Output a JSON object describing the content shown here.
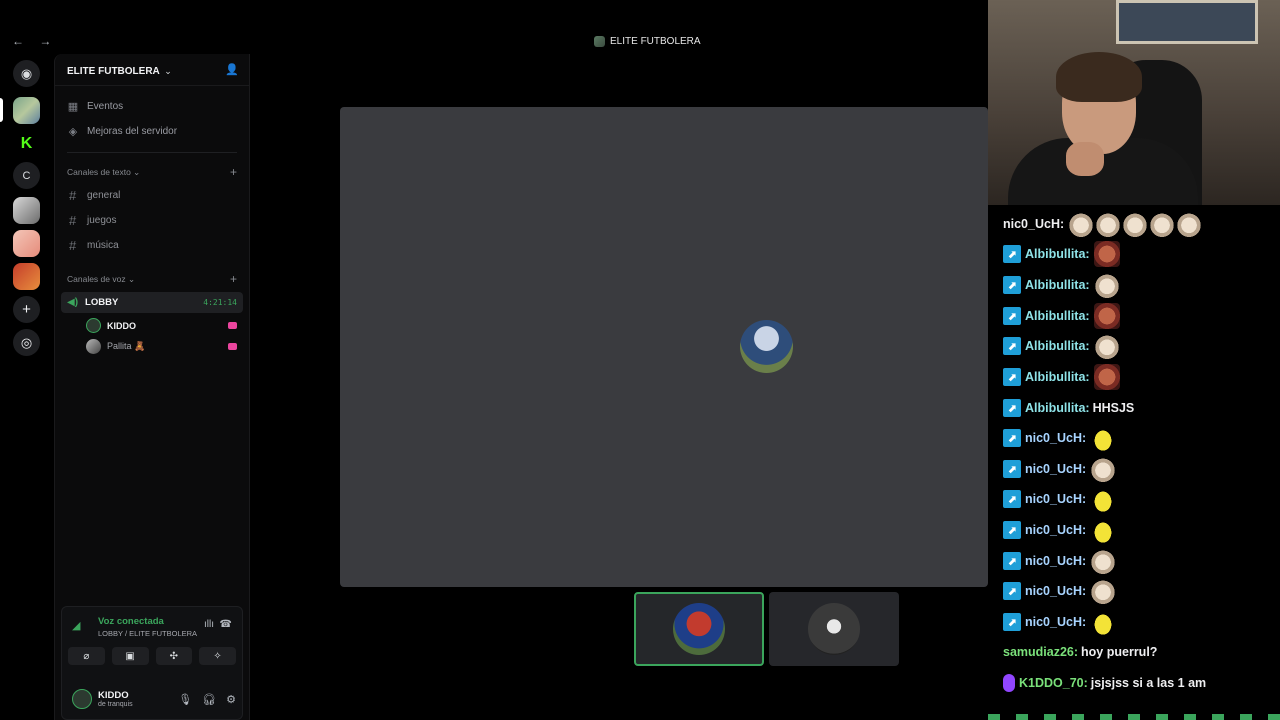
{
  "window": {
    "title": "ELITE FUTBOLERA",
    "nav": "← →"
  },
  "rail": {
    "items": [
      {
        "name": "discord-home-icon",
        "glyph": "◉"
      },
      {
        "name": "server-elite-futbolera",
        "glyph": ""
      },
      {
        "name": "server-k",
        "glyph": "K"
      },
      {
        "name": "server-c",
        "glyph": "C"
      },
      {
        "name": "server-4",
        "glyph": ""
      },
      {
        "name": "server-5",
        "glyph": ""
      },
      {
        "name": "server-6",
        "glyph": ""
      },
      {
        "name": "add-server-icon",
        "glyph": "+"
      },
      {
        "name": "discover-icon",
        "glyph": "◎"
      }
    ]
  },
  "sidebar": {
    "guild_name": "ELITE FUTBOLERA",
    "guild_chevron": "⌄",
    "invite_icon": "👤",
    "top_items": [
      {
        "label": "Eventos",
        "icon": "calendar-icon",
        "glyph": "▦"
      },
      {
        "label": "Mejoras del servidor",
        "icon": "boost-icon",
        "glyph": "◈"
      }
    ],
    "text_category": "Canales de texto ⌄",
    "text_channels": [
      "general",
      "juegos",
      "música"
    ],
    "voice_category": "Canales de voz ⌄",
    "add": "+",
    "voice_channel": {
      "name": "LOBBY",
      "timer": "4:21:14",
      "users": [
        {
          "name": "KIDDO"
        },
        {
          "name": "Pallita 🧸"
        }
      ]
    }
  },
  "voice_panel": {
    "status": "Voz conectada",
    "location": "LOBBY / ELITE FUTBOLERA",
    "buttons": [
      "⌀",
      "▣",
      "✣",
      "✧"
    ],
    "user": {
      "name": "KIDDO",
      "status": "de tranquis"
    }
  },
  "chat": {
    "messages": [
      {
        "user": "nic0_UcH:",
        "text": "",
        "color": "#efeff1",
        "emotes": [
          "cat",
          "cat",
          "cat",
          "cat",
          "cat"
        ],
        "badge": false
      },
      {
        "user": "Albibullita:",
        "text": "",
        "color": "#8fe3e8",
        "emotes": [
          "face"
        ],
        "badge": true
      },
      {
        "user": "Albibullita:",
        "text": "",
        "color": "#8fe3e8",
        "emotes": [
          "cat"
        ],
        "badge": true
      },
      {
        "user": "Albibullita:",
        "text": "",
        "color": "#8fe3e8",
        "emotes": [
          "face"
        ],
        "badge": true
      },
      {
        "user": "Albibullita:",
        "text": "",
        "color": "#8fe3e8",
        "emotes": [
          "cat"
        ],
        "badge": true
      },
      {
        "user": "Albibullita:",
        "text": "",
        "color": "#8fe3e8",
        "emotes": [
          "face"
        ],
        "badge": true
      },
      {
        "user": "Albibullita:",
        "text": "HHSJS",
        "color": "#8fe3e8",
        "emotes": [],
        "badge": true
      },
      {
        "user": "nic0_UcH:",
        "text": "",
        "color": "#a8d4ff",
        "emotes": [
          "yellow"
        ],
        "badge": true
      },
      {
        "user": "nic0_UcH:",
        "text": "",
        "color": "#a8d4ff",
        "emotes": [
          "cat"
        ],
        "badge": true
      },
      {
        "user": "nic0_UcH:",
        "text": "",
        "color": "#a8d4ff",
        "emotes": [
          "yellow"
        ],
        "badge": true
      },
      {
        "user": "nic0_UcH:",
        "text": "",
        "color": "#a8d4ff",
        "emotes": [
          "yellow"
        ],
        "badge": true
      },
      {
        "user": "nic0_UcH:",
        "text": "",
        "color": "#a8d4ff",
        "emotes": [
          "cat"
        ],
        "badge": true
      },
      {
        "user": "nic0_UcH:",
        "text": "",
        "color": "#a8d4ff",
        "emotes": [
          "cat"
        ],
        "badge": true
      },
      {
        "user": "nic0_UcH:",
        "text": "",
        "color": "#a8d4ff",
        "emotes": [
          "yellow"
        ],
        "badge": true
      },
      {
        "user": "samudiaz26:",
        "text": "hoy puerrul?",
        "color": "#7ae07a",
        "emotes": [],
        "badge": false
      },
      {
        "user": "K1DDO_70:",
        "text": "jsjsjss si a las 1 am",
        "color": "#7ae07a",
        "emotes": [],
        "badge": "purple"
      }
    ]
  },
  "colors": {
    "accent_green": "#3ba55c",
    "stage": "#3a3b3f",
    "twitch_badge": "#1f9fd8"
  }
}
